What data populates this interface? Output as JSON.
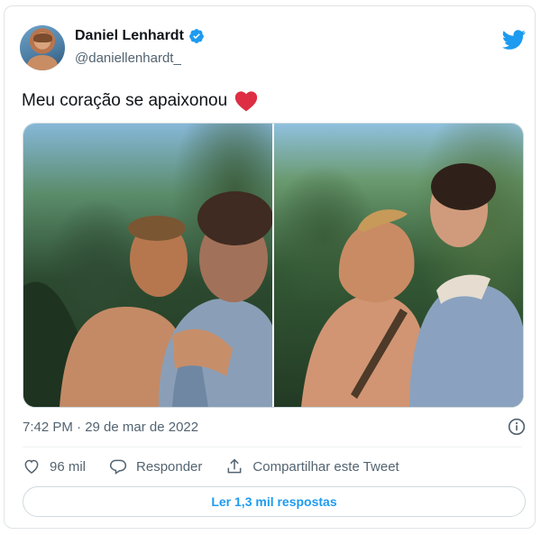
{
  "author": {
    "display_name": "Daniel Lenhardt",
    "handle": "@daniellenhardt_",
    "verified": true
  },
  "tweet": {
    "text": "Meu coração se apaixonou",
    "emoji": "red-heart"
  },
  "timestamp": "7:42 PM · 29 de mar de 2022",
  "actions": {
    "like_count": "96 mil",
    "reply_label": "Responder",
    "share_label": "Compartilhar este Tweet"
  },
  "replies_button": "Ler 1,3 mil respostas",
  "colors": {
    "accent": "#1d9bf0",
    "secondary_text": "#536471",
    "heart": "#e0245e"
  },
  "icons": [
    "twitter-bird-icon",
    "verified-badge-icon",
    "heart-emoji-icon",
    "info-icon",
    "like-icon",
    "reply-icon",
    "share-icon"
  ]
}
